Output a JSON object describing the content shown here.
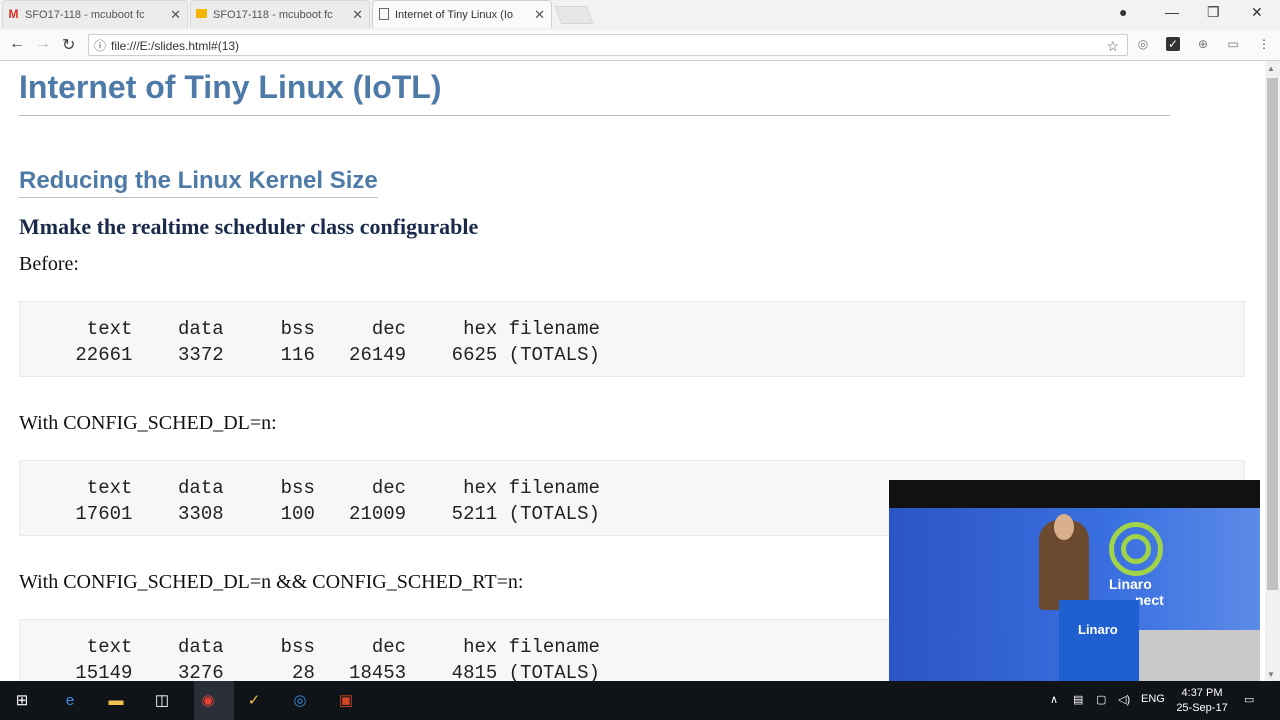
{
  "tabs": [
    {
      "label": "SFO17-118 - mcuboot fc",
      "icon": "gmail-icon",
      "color": "#d93025"
    },
    {
      "label": "SFO17-118 - mcuboot fc",
      "icon": "slides-icon",
      "color": "#f4b400"
    },
    {
      "label": "Internet of Tiny Linux (Io",
      "icon": "page-icon",
      "color": "#555555"
    }
  ],
  "address_bar": {
    "url": "file:///E:/slides.html#(13)"
  },
  "slide": {
    "title": "Internet of Tiny Linux (IoTL)",
    "subtitle": "Reducing the Linux Kernel Size",
    "heading": "Mmake the realtime scheduler class configurable",
    "sections": [
      {
        "label": "Before:",
        "header": "  text    data     bss     dec     hex filename",
        "row": " 22661    3372     116   26149    6625 (TOTALS)"
      },
      {
        "label": "With CONFIG_SCHED_DL=n:",
        "header": "  text    data     bss     dec     hex filename",
        "row": " 17601    3308     100   21009    5211 (TOTALS)"
      },
      {
        "label": "With CONFIG_SCHED_DL=n && CONFIG_SCHED_RT=n:",
        "header": "  text    data     bss     dec     hex filename",
        "row": " 15149    3276      28   18453    4815 (TOTALS)"
      }
    ]
  },
  "video": {
    "logo_text": "Linaro",
    "logo_text2": "nect",
    "podium_text": "Linaro"
  },
  "taskbar": {
    "lang": "ENG",
    "time": "4:37 PM",
    "date": "25-Sep-17"
  },
  "colors": {
    "title": "#4d7aa7",
    "heading": "#1a2b4a",
    "taskbar": "#101318"
  }
}
